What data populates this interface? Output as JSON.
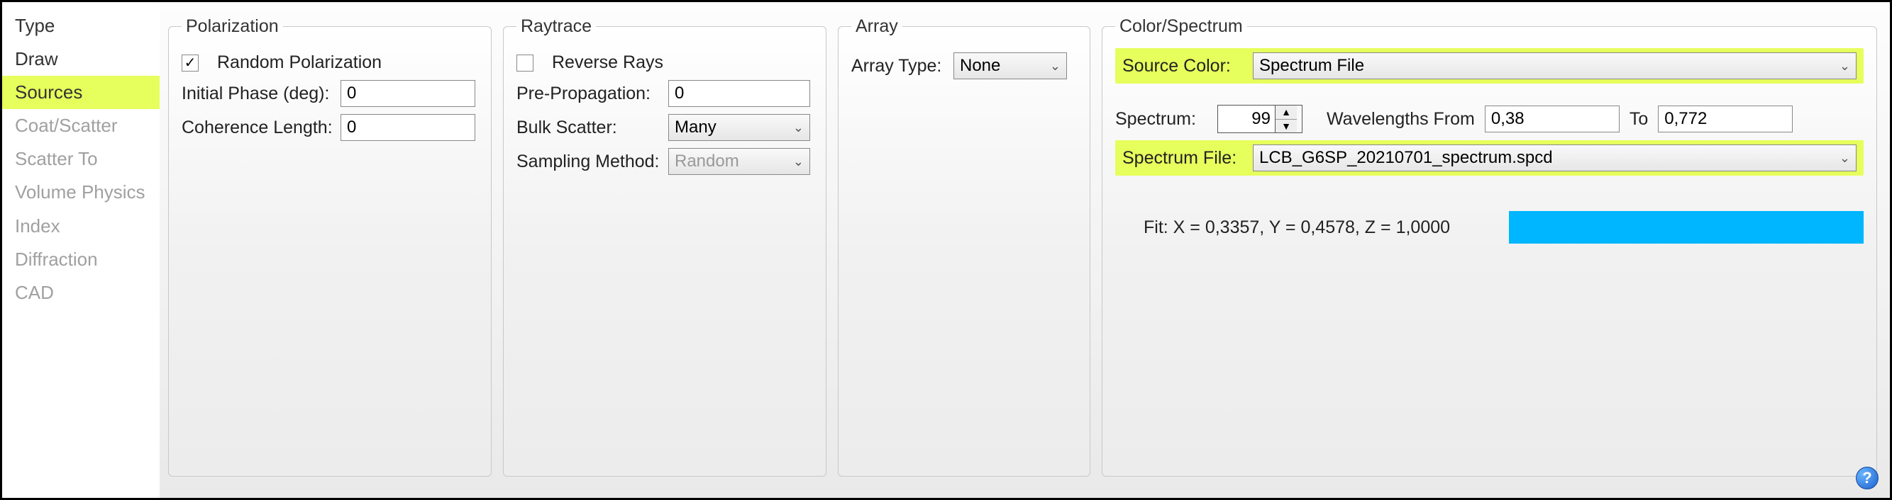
{
  "sidebar": {
    "items": [
      {
        "label": "Type",
        "state": "normal"
      },
      {
        "label": "Draw",
        "state": "normal"
      },
      {
        "label": "Sources",
        "state": "selected"
      },
      {
        "label": "Coat/Scatter",
        "state": "dimmed"
      },
      {
        "label": "Scatter To",
        "state": "dimmed"
      },
      {
        "label": "Volume Physics",
        "state": "dimmed"
      },
      {
        "label": "Index",
        "state": "dimmed"
      },
      {
        "label": "Diffraction",
        "state": "dimmed"
      },
      {
        "label": "CAD",
        "state": "dimmed"
      }
    ]
  },
  "polarization": {
    "legend": "Polarization",
    "random_label": "Random Polarization",
    "random_checked": true,
    "initial_phase_label": "Initial Phase (deg):",
    "initial_phase_value": "0",
    "coherence_label": "Coherence Length:",
    "coherence_value": "0"
  },
  "raytrace": {
    "legend": "Raytrace",
    "reverse_label": "Reverse Rays",
    "reverse_checked": false,
    "prepropagation_label": "Pre-Propagation:",
    "prepropagation_value": "0",
    "bulk_scatter_label": "Bulk Scatter:",
    "bulk_scatter_value": "Many",
    "sampling_label": "Sampling Method:",
    "sampling_value": "Random"
  },
  "array": {
    "legend": "Array",
    "type_label": "Array Type:",
    "type_value": "None"
  },
  "color": {
    "legend": "Color/Spectrum",
    "source_color_label": "Source Color:",
    "source_color_value": "Spectrum File",
    "spectrum_label": "Spectrum:",
    "spectrum_value": "99",
    "wavelengths_label": "Wavelengths From",
    "wavelengths_from": "0,38",
    "to_label": "To",
    "wavelengths_to": "0,772",
    "file_label": "Spectrum File:",
    "file_value": "LCB_G6SP_20210701_spectrum.spcd",
    "fit_text": "Fit: X = 0,3357, Y = 0,4578, Z = 1,0000",
    "swatch_color": "#00b6ff"
  },
  "help_icon_glyph": "?"
}
